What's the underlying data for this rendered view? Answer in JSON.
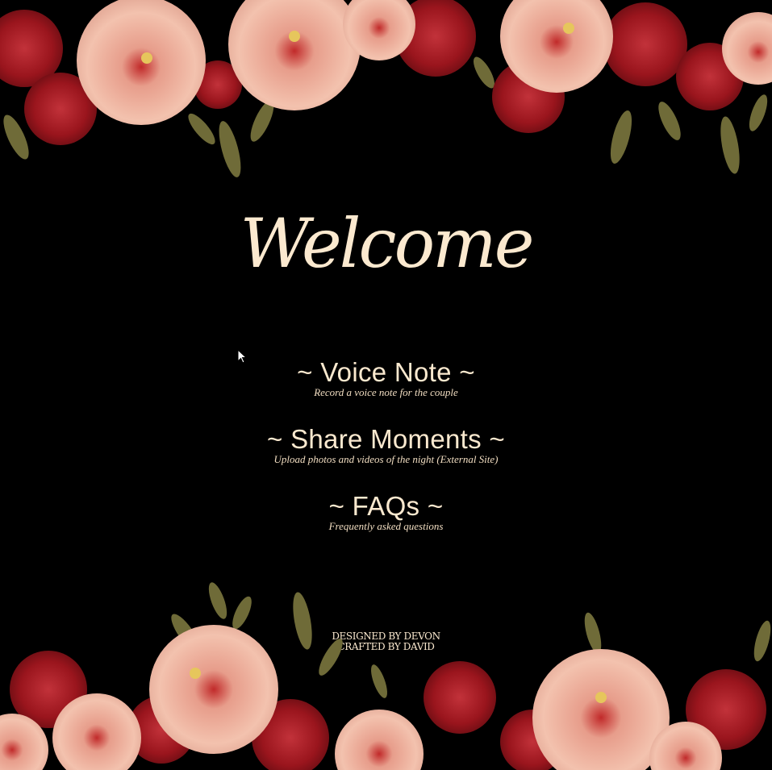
{
  "welcome": {
    "title": "Welcome"
  },
  "menu": {
    "items": [
      {
        "title": "~ Voice Note ~",
        "subtitle": "Record a voice note for the couple"
      },
      {
        "title": "~ Share Moments ~",
        "subtitle": "Upload photos and videos of the night (External Site)"
      },
      {
        "title": "~ FAQs ~",
        "subtitle": "Frequently asked questions"
      }
    ]
  },
  "footer": {
    "designed_by": "DESIGNED BY DEVON",
    "crafted_by": "CRAFTED BY DAVID"
  },
  "colors": {
    "background": "#000000",
    "text_cream": "#fbe9cf",
    "flower_blush": "#e9b5a0",
    "flower_red": "#9b1b22",
    "leaf_olive": "#6b6a35"
  },
  "icons": {
    "floral_border": "hibiscus-and-carnation-floral-icon",
    "cursor": "mouse-pointer-icon"
  }
}
